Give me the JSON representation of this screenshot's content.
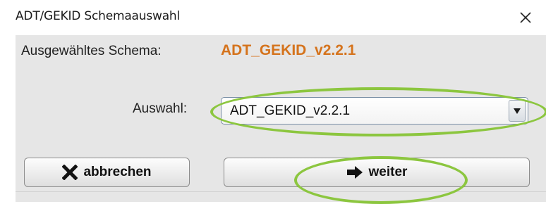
{
  "window": {
    "title": "ADT/GEKID Schemaauswahl",
    "close_icon": "close-icon"
  },
  "schema": {
    "label": "Ausgewähltes Schema:",
    "value": "ADT_GEKID_v2.2.1",
    "value_color": "#d5731c"
  },
  "selection": {
    "label": "Auswahl:",
    "selected": "ADT_GEKID_v2.2.1",
    "arrow_icon": "dropdown-arrow-icon"
  },
  "buttons": {
    "cancel_label": "abbrechen",
    "cancel_icon": "x-icon",
    "next_label": "weiter",
    "next_icon": "arrow-right-icon"
  },
  "annotation": {
    "highlight_color": "#8cc63f"
  }
}
